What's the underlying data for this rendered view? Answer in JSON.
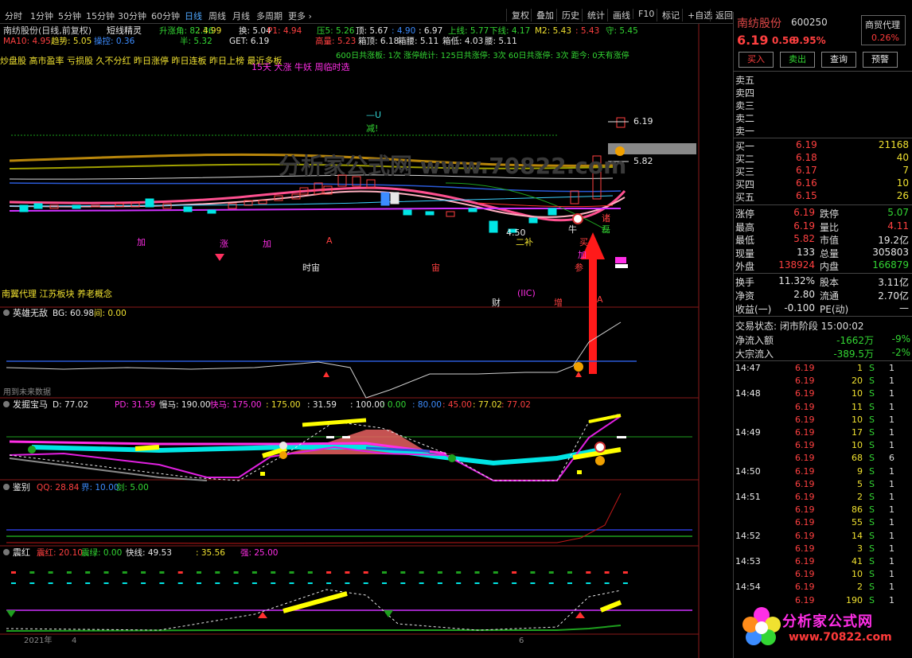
{
  "toolbar": {
    "periods": [
      "分时",
      "1分钟",
      "5分钟",
      "15分钟",
      "30分钟",
      "60分钟",
      "日线",
      "周线",
      "月线",
      "多周期",
      "更多 ›"
    ],
    "active_period": "日线",
    "functions": [
      "复权",
      "叠加",
      "历史",
      "统计",
      "画线",
      "F10",
      "标记",
      "+自选",
      "返回"
    ]
  },
  "main_chart": {
    "title": "南纺股份(日线,前复权)",
    "indicator": "短线精灵",
    "row1": [
      {
        "label": "升涨角: 82.36",
        "color": "#33d633"
      },
      {
        "label": ": 4.99",
        "color": "#f0e130"
      },
      {
        "label": "换: 5.04",
        "color": "#e8e8e8"
      },
      {
        "label": "P1: 4.94",
        "color": "#ff4040"
      },
      {
        "label": "压5: 5.26",
        "color": "#33d633"
      },
      {
        "label": "顶: 5.67",
        "color": "#e8e8e8"
      },
      {
        "label": ": 4.90",
        "color": "#3c8cff"
      },
      {
        "label": ": 6.97",
        "color": "#e8e8e8"
      },
      {
        "label": "上线: 5.77",
        "color": "#33d633"
      },
      {
        "label": "下线: 4.17",
        "color": "#33d633"
      },
      {
        "label": "M2: 5.43",
        "color": "#f0e130"
      },
      {
        "label": ": 5.43",
        "color": "#ff4040"
      },
      {
        "label": "守: 5.45",
        "color": "#33d633"
      }
    ],
    "row2": [
      {
        "label": "MA10: 4.95",
        "color": "#ff4040"
      },
      {
        "label": "趋势: 5.05",
        "color": "#f0e130"
      },
      {
        "label": "操控: 0.36",
        "color": "#3c8cff"
      },
      {
        "label": "半: 5.32",
        "color": "#33d633"
      },
      {
        "label": "GET: 6.19",
        "color": "#e8e8e8"
      },
      {
        "label": "高量: 5.23",
        "color": "#ff4040"
      },
      {
        "label": "箱顶: 6.18",
        "color": "#e8e8e8"
      },
      {
        "label": "箱腰: 5.11",
        "color": "#e8e8e8"
      },
      {
        "label": "箱低: 4.03",
        "color": "#e8e8e8"
      },
      {
        "label": "腰: 5.11",
        "color": "#e8e8e8"
      }
    ],
    "stats_line": "600日共涨板: 1次    涨停统计: 125日共涨停: 3次    60日共涨停: 3次    距今: 0天有涨停",
    "tags_line": "炒盘股 高市盈率 亏损股 久不分红 昨日涨停 昨日连板 昨日上榜 最近多板",
    "tags_line2": "15天 大涨 牛妖 周临时选",
    "concept_line": "南翼代理 江苏板块 养老概念",
    "y_ticks": [
      "7.00",
      "6.50",
      "6.00",
      "5.50",
      "5.00",
      "4.50"
    ],
    "annotations": [
      {
        "text": "加",
        "color": "#ff2ee6"
      },
      {
        "text": "涨",
        "color": "#ff2ee6"
      },
      {
        "text": "加",
        "color": "#ff2ee6"
      },
      {
        "text": "A",
        "color": "#ff4040"
      },
      {
        "text": "时宙",
        "color": "#e8e8e8"
      },
      {
        "text": "宙",
        "color": "#ff4040"
      },
      {
        "text": "二补",
        "color": "#f0e130"
      },
      {
        "text": "4.50",
        "color": "#e8e8e8"
      },
      {
        "text": "牛",
        "color": "#e8e8e8"
      },
      {
        "text": "买",
        "color": "#ff4040"
      },
      {
        "text": "加",
        "color": "#ff2ee6"
      },
      {
        "text": "参",
        "color": "#ff4040"
      },
      {
        "text": "诸",
        "color": "#ff4040"
      },
      {
        "text": "磊",
        "color": "#33d633"
      },
      {
        "text": "—U",
        "color": "#33d6d6"
      },
      {
        "text": "减!",
        "color": "#33d633"
      },
      {
        "text": "6.19",
        "color": "#e8e8e8"
      },
      {
        "text": "5.82",
        "color": "#e8e8e8"
      },
      {
        "text": "财",
        "color": "#e8e8e8"
      },
      {
        "text": "增",
        "color": "#ff4040"
      },
      {
        "text": "(IIC)",
        "color": "#ff2ee6"
      },
      {
        "text": "A",
        "color": "#ff4040"
      }
    ]
  },
  "panels": [
    {
      "name": "英雄无敌",
      "values": [
        {
          "label": "BG: 60.98",
          "color": "#e8e8e8"
        },
        {
          "label": "间: 0.00",
          "color": "#f0e130"
        }
      ],
      "note": "用到未来数据",
      "y_ticks": [
        "50.00",
        "25.00",
        "0.00"
      ]
    },
    {
      "name": "发掘宝马",
      "values": [
        {
          "label": "D: 77.02",
          "color": "#e8e8e8"
        },
        {
          "label": "PD: 31.59",
          "color": "#ff2ee6"
        },
        {
          "label": "慢马: 190.00",
          "color": "#e8e8e8"
        },
        {
          "label": "快马: 175.00",
          "color": "#ff2ee6"
        },
        {
          "label": ": 175.00",
          "color": "#f0e130"
        },
        {
          "label": ": 31.59",
          "color": "#e8e8e8"
        },
        {
          "label": ": 100.00",
          "color": "#e8e8e8"
        },
        {
          "label": ": 0.00",
          "color": "#33d633"
        },
        {
          "label": ": 80.00",
          "color": "#3c8cff"
        },
        {
          "label": ": 45.00",
          "color": "#ff4040"
        },
        {
          "label": ": 77.02",
          "color": "#f0e130"
        },
        {
          "label": ": 77.02",
          "color": "#ff4040"
        }
      ],
      "y_ticks": [
        "100.0"
      ]
    },
    {
      "name": "鉴别",
      "values": [
        {
          "label": "QQ: 28.84",
          "color": "#ff4040"
        },
        {
          "label": "界: 10.00",
          "color": "#3c8cff"
        },
        {
          "label": "剑: 5.00",
          "color": "#33d633"
        }
      ],
      "y_ticks": [
        "20.00",
        "10.00"
      ]
    },
    {
      "name": "震红",
      "values": [
        {
          "label": "震红: 20.10",
          "color": "#ff4040"
        },
        {
          "label": "震绿: 0.00",
          "color": "#33d633"
        },
        {
          "label": "快线: 49.53",
          "color": "#e8e8e8"
        },
        {
          "label": ": 35.56",
          "color": "#f0e130"
        },
        {
          "label": "强: 25.00",
          "color": "#ff2ee6"
        }
      ],
      "y_ticks": [
        "60.00",
        "40.00",
        "20.00"
      ]
    }
  ],
  "bottom_axis": {
    "left": "2021年",
    "mid1": "4",
    "mid2": "6",
    "right": "日线"
  },
  "watermark_chart": "分析家公式网 www.70822.com",
  "right_panel": {
    "name": "南纺股份",
    "code": "600250",
    "badge_line1": "商贸代理",
    "badge_line2": "0.26%",
    "price": "6.19",
    "change": "0.56",
    "pct": "9.95%",
    "buttons": [
      {
        "label": "买入",
        "color": "#ff4040"
      },
      {
        "label": "卖出",
        "color": "#33d633"
      },
      {
        "label": "查询",
        "color": "#e8e8e8"
      },
      {
        "label": "预警",
        "color": "#e8e8e8"
      }
    ],
    "sell_levels": [
      "卖五",
      "卖四",
      "卖三",
      "卖二",
      "卖一"
    ],
    "buy_levels": [
      {
        "label": "买一",
        "price": "6.19",
        "vol": "21168"
      },
      {
        "label": "买二",
        "price": "6.18",
        "vol": "40"
      },
      {
        "label": "买三",
        "price": "6.17",
        "vol": "7"
      },
      {
        "label": "买四",
        "price": "6.16",
        "vol": "10"
      },
      {
        "label": "买五",
        "price": "6.15",
        "vol": "26"
      }
    ],
    "stats": [
      {
        "l1": "涨停",
        "v1": "6.19",
        "c1": "#ff4040",
        "l2": "跌停",
        "v2": "5.07",
        "c2": "#33d633"
      },
      {
        "l1": "最高",
        "v1": "6.19",
        "c1": "#ff4040",
        "l2": "量比",
        "v2": "4.11",
        "c2": "#ff4040"
      },
      {
        "l1": "最低",
        "v1": "5.82",
        "c1": "#ff4040",
        "l2": "市值",
        "v2": "19.2亿",
        "c2": "#e8e8e8"
      },
      {
        "l1": "现量",
        "v1": "133",
        "c1": "#e8e8e8",
        "l2": "总量",
        "v2": "305803",
        "c2": "#e8e8e8"
      },
      {
        "l1": "外盘",
        "v1": "138924",
        "c1": "#ff4040",
        "l2": "内盘",
        "v2": "166879",
        "c2": "#33d633"
      }
    ],
    "stats2": [
      {
        "l1": "换手",
        "v1": "11.32%",
        "c1": "#e8e8e8",
        "l2": "股本",
        "v2": "3.11亿",
        "c2": "#e8e8e8"
      },
      {
        "l1": "净资",
        "v1": "2.80",
        "c1": "#e8e8e8",
        "l2": "流通",
        "v2": "2.70亿",
        "c2": "#e8e8e8"
      },
      {
        "l1": "收益(一)",
        "v1": "-0.100",
        "c1": "#e8e8e8",
        "l2": "PE(动)",
        "v2": "—",
        "c2": "#e8e8e8"
      }
    ],
    "trade_status": "交易状态: 闭市阶段 15:00:02",
    "flows": [
      {
        "label": "净流入额",
        "value": "-1662万",
        "pct": "-9%"
      },
      {
        "label": "大宗流入",
        "value": "-389.5万",
        "pct": "-2%"
      }
    ],
    "ticks": [
      {
        "time": "14:47",
        "price": "6.19",
        "vol": "1",
        "bs": "S",
        "n": "1"
      },
      {
        "time": "",
        "price": "6.19",
        "vol": "20",
        "bs": "S",
        "n": "1"
      },
      {
        "time": "14:48",
        "price": "6.19",
        "vol": "10",
        "bs": "S",
        "n": "1"
      },
      {
        "time": "",
        "price": "6.19",
        "vol": "11",
        "bs": "S",
        "n": "1"
      },
      {
        "time": "",
        "price": "6.19",
        "vol": "10",
        "bs": "S",
        "n": "1"
      },
      {
        "time": "14:49",
        "price": "6.19",
        "vol": "17",
        "bs": "S",
        "n": "1"
      },
      {
        "time": "",
        "price": "6.19",
        "vol": "10",
        "bs": "S",
        "n": "1"
      },
      {
        "time": "",
        "price": "6.19",
        "vol": "68",
        "bs": "S",
        "n": "6"
      },
      {
        "time": "14:50",
        "price": "6.19",
        "vol": "9",
        "bs": "S",
        "n": "1"
      },
      {
        "time": "",
        "price": "6.19",
        "vol": "5",
        "bs": "S",
        "n": "1"
      },
      {
        "time": "14:51",
        "price": "6.19",
        "vol": "2",
        "bs": "S",
        "n": "1"
      },
      {
        "time": "",
        "price": "6.19",
        "vol": "86",
        "bs": "S",
        "n": "1"
      },
      {
        "time": "",
        "price": "6.19",
        "vol": "55",
        "bs": "S",
        "n": "1"
      },
      {
        "time": "14:52",
        "price": "6.19",
        "vol": "14",
        "bs": "S",
        "n": "1"
      },
      {
        "time": "",
        "price": "6.19",
        "vol": "3",
        "bs": "S",
        "n": "1"
      },
      {
        "time": "14:53",
        "price": "6.19",
        "vol": "41",
        "bs": "S",
        "n": "1"
      },
      {
        "time": "",
        "price": "6.19",
        "vol": "10",
        "bs": "S",
        "n": "1"
      },
      {
        "time": "14:54",
        "price": "6.19",
        "vol": "2",
        "bs": "S",
        "n": "1"
      },
      {
        "time": "",
        "price": "6.19",
        "vol": "190",
        "bs": "S",
        "n": "1"
      }
    ]
  },
  "watermark": {
    "line1": "分析家公式网",
    "line2": "www.70822.com"
  }
}
